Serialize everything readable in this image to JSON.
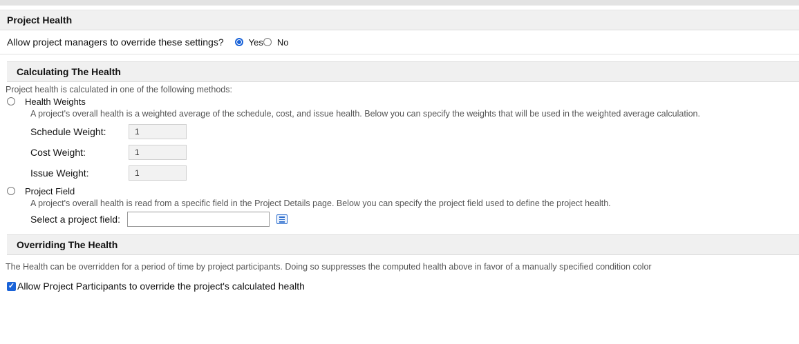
{
  "project_health": {
    "title": "Project Health",
    "override_question": "Allow project managers to override these settings?",
    "override_options": {
      "yes": "Yes",
      "no": "No",
      "selected": "Yes"
    }
  },
  "calculating": {
    "title": "Calculating The Health",
    "intro": "Project health is calculated in one of the following methods:",
    "health_weights": {
      "label": "Health Weights",
      "description": "A project's overall health is a weighted average of the schedule, cost, and issue health. Below you can specify the weights that will be used in the weighted average calculation.",
      "fields": [
        {
          "label": "Schedule Weight:",
          "value": "1"
        },
        {
          "label": "Cost Weight:",
          "value": "1"
        },
        {
          "label": "Issue Weight:",
          "value": "1"
        }
      ]
    },
    "project_field": {
      "label": "Project Field",
      "description": "A project's overall health is read from a specific field in the Project Details page. Below you can specify the project field used to define the project health.",
      "select_label": "Select a project field:",
      "select_value": "",
      "picker_icon": "list-picker-icon"
    }
  },
  "overriding": {
    "title": "Overriding The Health",
    "description": "The Health can be overridden for a period of time by project participants. Doing so suppresses the computed health above in favor of a manually specified condition color",
    "allow_label": "Allow Project Participants to override the project's calculated health",
    "allow_checked": true
  },
  "colors": {
    "accent": "#1a63d8",
    "header_bg": "#f0f0f0",
    "topbar": "#e3e3e3"
  }
}
